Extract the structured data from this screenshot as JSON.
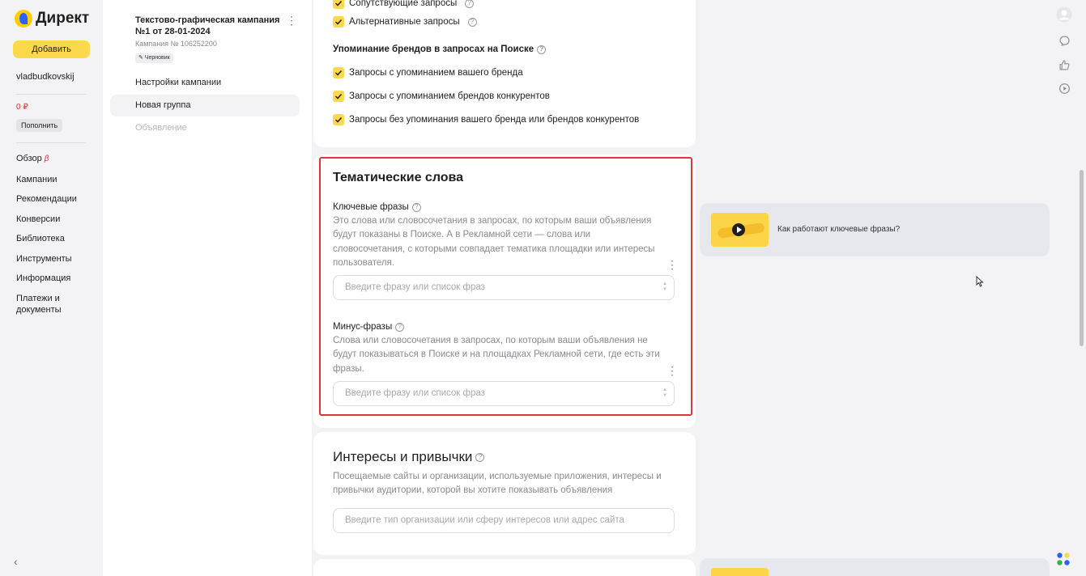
{
  "nav": {
    "logo_text": "Директ",
    "add_button": "Добавить",
    "username": "vladbudkovskij",
    "balance": "0 ₽",
    "topup_button": "Пополнить",
    "items": [
      {
        "label": "Обзор",
        "badge": "β"
      },
      {
        "label": "Кампании"
      },
      {
        "label": "Рекомендации"
      },
      {
        "label": "Конверсии"
      },
      {
        "label": "Библиотека"
      },
      {
        "label": "Инструменты"
      },
      {
        "label": "Информация"
      },
      {
        "label": "Платежи и документы"
      }
    ],
    "collapse_icon": "chevron-left-icon"
  },
  "campaign": {
    "title": "Текстово-графическая кампания №1 от 28-01-2024",
    "number": "Кампания № 106252200",
    "status": "✎ Черновик",
    "items": [
      {
        "label": "Настройки кампании",
        "state": "normal"
      },
      {
        "label": "Новая группа",
        "state": "active"
      },
      {
        "label": "Объявление",
        "state": "disabled"
      }
    ]
  },
  "queries": {
    "related": "Сопутствующие запросы",
    "alternative": "Альтернативные запросы",
    "brand_section": "Упоминание брендов в запросах на Поиске",
    "brand_options": [
      "Запросы с упоминанием вашего бренда",
      "Запросы с упоминанием брендов конкурентов",
      "Запросы без упоминания вашего бренда или брендов конкурентов"
    ]
  },
  "thematic": {
    "title": "Тематические слова",
    "keywords_label": "Ключевые фразы",
    "keywords_desc": "Это слова или словосочетания в запросах, по которым ваши объявления будут показаны в Поиске. А в Рекламной сети — слова или словосочетания, с которыми совпадает тематика площадки или интересы пользователя.",
    "keywords_placeholder": "Введите фразу или список фраз",
    "minus_label": "Минус-фразы",
    "minus_desc": "Слова или словосочетания в запросах, по которым ваши объявления не будут показываться в Поиске и на площадках Рекламной сети, где есть эти фразы.",
    "minus_placeholder": "Введите фразу или список фраз"
  },
  "interests": {
    "title": "Интересы и привычки",
    "desc": "Посещаемые сайты и организации, используемые приложения, интересы и привычки аудитории, которой вы хотите показывать объявления",
    "placeholder": "Введите тип организации или сферу интересов или адрес сайта"
  },
  "tip": {
    "text": "Как работают ключевые фразы?"
  },
  "colors": {
    "accent_yellow": "#fcd94c",
    "highlight_red": "#d9363e",
    "balance_red": "#dd3333"
  }
}
